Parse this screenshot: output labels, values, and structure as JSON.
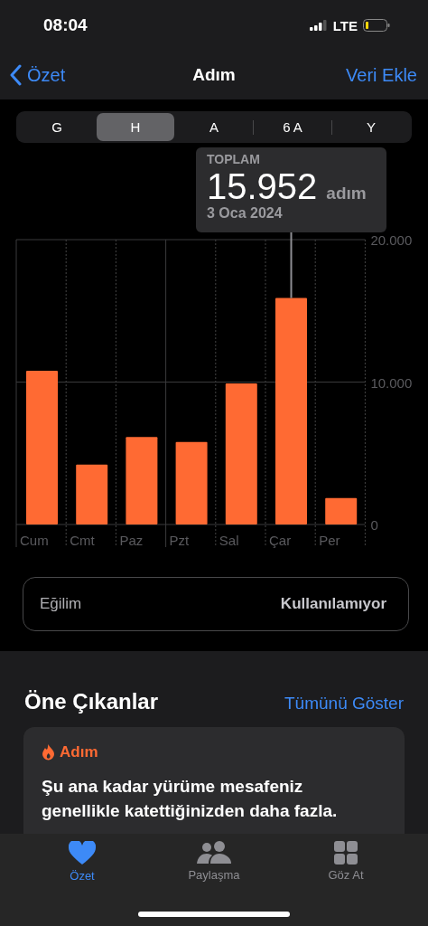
{
  "status_bar": {
    "time": "08:04",
    "network": "LTE"
  },
  "nav": {
    "back": "Özet",
    "title": "Adım",
    "action": "Veri Ekle"
  },
  "segments": [
    {
      "label": "G",
      "selected": false
    },
    {
      "label": "H",
      "selected": true
    },
    {
      "label": "A",
      "selected": false
    },
    {
      "label": "6 A",
      "selected": false
    },
    {
      "label": "Y",
      "selected": false
    }
  ],
  "chart": {
    "tooltip": {
      "label": "TOPLAM",
      "value": "15.952",
      "unit": "adım",
      "date": "3 Oca 2024"
    },
    "selected_bars": [
      false,
      false,
      false,
      false,
      false,
      true,
      false
    ],
    "chart_data": {
      "type": "bar",
      "categories": [
        "Cum",
        "Cmt",
        "Paz",
        "Pzt",
        "Sal",
        "Çar",
        "Per"
      ],
      "series": [
        {
          "color": "#ff6a33",
          "values": [
            10800,
            4200,
            6150,
            5800,
            9900,
            15900,
            1850
          ]
        }
      ],
      "ylim": [
        0,
        20000
      ],
      "yticks": [
        {
          "value": 0,
          "label": "0"
        },
        {
          "value": 10000,
          "label": "10.000"
        },
        {
          "value": 20000,
          "label": "20.000"
        }
      ]
    }
  },
  "trend": {
    "label": "Eğilim",
    "value": "Kullanılamıyor"
  },
  "highlights": {
    "title": "Öne Çıkanlar",
    "link": "Tümünü Göster",
    "cards": [
      {
        "category": "Adım",
        "text": "Şu ana kadar yürüme mesafeniz genellikle katettiğinizden daha fazla."
      }
    ]
  },
  "tab_bar": [
    {
      "label": "Özet",
      "kind": "heart",
      "selected": true
    },
    {
      "label": "Paylaşma",
      "kind": "people",
      "selected": false
    },
    {
      "label": "Göz At",
      "kind": "grid",
      "selected": false
    }
  ]
}
